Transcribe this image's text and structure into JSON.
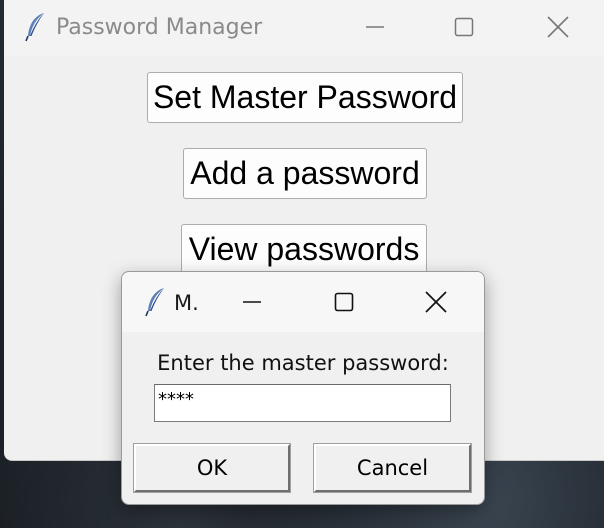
{
  "main_window": {
    "title": "Password Manager",
    "buttons": {
      "set_master": "Set Master Password",
      "add_password": "Add a password",
      "view_passwords": "View passwords"
    }
  },
  "dialog": {
    "title": "M.",
    "prompt": "Enter the master password:",
    "entry_value": "****",
    "ok_label": "OK",
    "cancel_label": "Cancel"
  },
  "icons": {
    "app": "feather-icon",
    "minimize": "minimize-icon",
    "maximize": "maximize-icon",
    "close": "close-icon"
  }
}
